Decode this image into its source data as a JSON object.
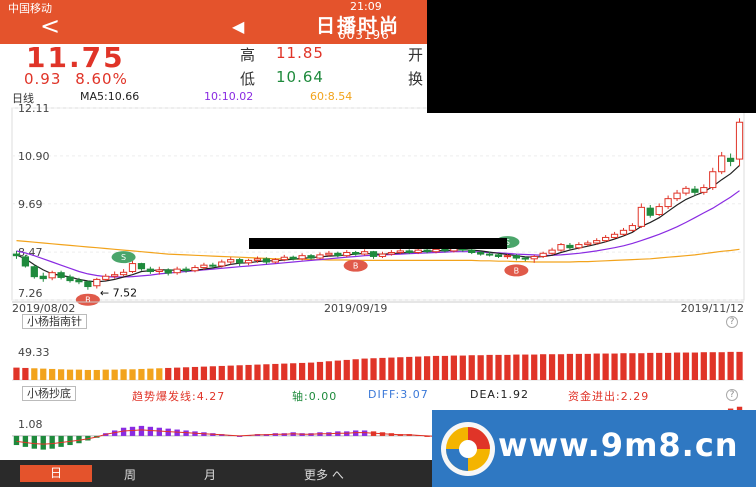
{
  "status": {
    "carrier": "中国移动",
    "time": "21:09"
  },
  "header": {
    "back_icon": "chevron-left",
    "stock_name": "日播时尚",
    "stock_code": "603196"
  },
  "quote": {
    "price": "11.75",
    "change": "0.93",
    "change_pct": "8.60%",
    "high_label": "高",
    "high": "11.85",
    "low_label": "低",
    "low": "10.64",
    "open_label": "开",
    "turnover_label": "换"
  },
  "legend": {
    "period": "日线",
    "ma5": "MA5:10.66",
    "ma10": "10:10.02",
    "ma60": "60:8.54"
  },
  "colors": {
    "up": "#e03428",
    "down": "#1e8a3c",
    "ma5": "#222222",
    "ma10": "#8a2be2",
    "ma60": "#f2a31c",
    "accent": "#e4532c"
  },
  "chart_data": {
    "type": "candlestick",
    "y_ticks": [
      "12.11",
      "10.90",
      "9.69",
      "8.47",
      "7.26"
    ],
    "ylim": [
      7.26,
      12.11
    ],
    "x_labels": [
      "2019/08/02",
      "2019/09/19",
      "2019/11/12"
    ],
    "annotations": {
      "low_marker": "7.52"
    },
    "candles": [
      [
        8.42,
        8.38,
        8.5,
        8.3
      ],
      [
        8.35,
        8.12,
        8.4,
        8.08
      ],
      [
        8.1,
        7.85,
        8.15,
        7.8
      ],
      [
        7.86,
        7.8,
        7.95,
        7.72
      ],
      [
        7.82,
        7.95,
        8.0,
        7.76
      ],
      [
        7.95,
        7.83,
        8.0,
        7.78
      ],
      [
        7.84,
        7.75,
        7.9,
        7.7
      ],
      [
        7.76,
        7.72,
        7.82,
        7.66
      ],
      [
        7.72,
        7.6,
        7.75,
        7.52
      ],
      [
        7.62,
        7.78,
        7.82,
        7.55
      ],
      [
        7.78,
        7.86,
        7.92,
        7.74
      ],
      [
        7.86,
        7.9,
        7.98,
        7.8
      ],
      [
        7.9,
        7.96,
        8.04,
        7.86
      ],
      [
        7.98,
        8.18,
        8.25,
        7.94
      ],
      [
        8.18,
        8.05,
        8.2,
        8.0
      ],
      [
        8.04,
        7.98,
        8.1,
        7.92
      ],
      [
        7.98,
        8.02,
        8.1,
        7.9
      ],
      [
        8.02,
        7.94,
        8.06,
        7.88
      ],
      [
        7.95,
        8.04,
        8.1,
        7.9
      ],
      [
        8.04,
        8.0,
        8.1,
        7.95
      ],
      [
        8.0,
        8.08,
        8.14,
        7.96
      ],
      [
        8.08,
        8.14,
        8.2,
        8.02
      ],
      [
        8.14,
        8.12,
        8.2,
        8.06
      ],
      [
        8.12,
        8.22,
        8.28,
        8.08
      ],
      [
        8.22,
        8.28,
        8.34,
        8.16
      ],
      [
        8.28,
        8.2,
        8.32,
        8.12
      ],
      [
        8.2,
        8.26,
        8.3,
        8.14
      ],
      [
        8.26,
        8.3,
        8.36,
        8.2
      ],
      [
        8.3,
        8.22,
        8.34,
        8.16
      ],
      [
        8.22,
        8.28,
        8.32,
        8.18
      ],
      [
        8.28,
        8.34,
        8.4,
        8.24
      ],
      [
        8.34,
        8.3,
        8.38,
        8.26
      ],
      [
        8.3,
        8.38,
        8.44,
        8.26
      ],
      [
        8.38,
        8.32,
        8.42,
        8.28
      ],
      [
        8.32,
        8.4,
        8.46,
        8.28
      ],
      [
        8.4,
        8.44,
        8.5,
        8.36
      ],
      [
        8.44,
        8.38,
        8.48,
        8.34
      ],
      [
        8.38,
        8.46,
        8.52,
        8.34
      ],
      [
        8.46,
        8.42,
        8.5,
        8.38
      ],
      [
        8.42,
        8.48,
        8.54,
        8.38
      ],
      [
        8.48,
        8.36,
        8.5,
        8.3
      ],
      [
        8.36,
        8.42,
        8.48,
        8.32
      ],
      [
        8.42,
        8.46,
        8.52,
        8.38
      ],
      [
        8.46,
        8.5,
        8.56,
        8.42
      ],
      [
        8.5,
        8.46,
        8.54,
        8.42
      ],
      [
        8.46,
        8.52,
        8.58,
        8.42
      ],
      [
        8.52,
        8.48,
        8.56,
        8.44
      ],
      [
        8.48,
        8.54,
        8.6,
        8.44
      ],
      [
        8.54,
        8.5,
        8.58,
        8.46
      ],
      [
        8.5,
        8.56,
        8.62,
        8.46
      ],
      [
        8.56,
        8.52,
        8.6,
        8.48
      ],
      [
        8.52,
        8.46,
        8.56,
        8.42
      ],
      [
        8.46,
        8.42,
        8.5,
        8.38
      ],
      [
        8.42,
        8.4,
        8.48,
        8.36
      ],
      [
        8.4,
        8.36,
        8.44,
        8.32
      ],
      [
        8.36,
        8.38,
        8.42,
        8.3
      ],
      [
        8.38,
        8.32,
        8.42,
        8.26
      ],
      [
        8.32,
        8.3,
        8.36,
        8.24
      ],
      [
        8.3,
        8.36,
        8.4,
        8.2
      ],
      [
        8.36,
        8.44,
        8.48,
        8.32
      ],
      [
        8.44,
        8.52,
        8.58,
        8.4
      ],
      [
        8.52,
        8.66,
        8.7,
        8.48
      ],
      [
        8.64,
        8.58,
        8.7,
        8.54
      ],
      [
        8.58,
        8.66,
        8.72,
        8.54
      ],
      [
        8.66,
        8.7,
        8.76,
        8.62
      ],
      [
        8.7,
        8.76,
        8.82,
        8.66
      ],
      [
        8.76,
        8.84,
        8.9,
        8.72
      ],
      [
        8.84,
        8.92,
        8.98,
        8.8
      ],
      [
        8.92,
        9.02,
        9.08,
        8.88
      ],
      [
        9.02,
        9.14,
        9.2,
        8.98
      ],
      [
        9.12,
        9.6,
        9.7,
        9.08
      ],
      [
        9.58,
        9.4,
        9.66,
        9.34
      ],
      [
        9.42,
        9.62,
        9.7,
        9.38
      ],
      [
        9.62,
        9.82,
        9.9,
        9.56
      ],
      [
        9.82,
        9.96,
        10.04,
        9.76
      ],
      [
        9.96,
        10.08,
        10.14,
        9.9
      ],
      [
        10.06,
        9.98,
        10.14,
        9.9
      ],
      [
        9.98,
        10.1,
        10.18,
        9.92
      ],
      [
        10.1,
        10.5,
        10.6,
        10.04
      ],
      [
        10.5,
        10.9,
        11.0,
        10.44
      ],
      [
        10.84,
        10.76,
        10.96,
        10.64
      ],
      [
        10.82,
        11.75,
        11.85,
        10.64
      ]
    ],
    "ma5": [
      8.4,
      8.3,
      8.15,
      8.02,
      7.92,
      7.88,
      7.84,
      7.78,
      7.74,
      7.72,
      7.74,
      7.78,
      7.84,
      7.9,
      7.98,
      8.0,
      8.02,
      8.02,
      8.01,
      8.0,
      8.01,
      8.04,
      8.07,
      8.11,
      8.16,
      8.19,
      8.2,
      8.23,
      8.25,
      8.25,
      8.27,
      8.29,
      8.31,
      8.33,
      8.35,
      8.37,
      8.38,
      8.4,
      8.42,
      8.44,
      8.42,
      8.42,
      8.43,
      8.45,
      8.46,
      8.48,
      8.49,
      8.5,
      8.51,
      8.52,
      8.53,
      8.52,
      8.5,
      8.47,
      8.44,
      8.41,
      8.38,
      8.35,
      8.34,
      8.36,
      8.39,
      8.46,
      8.52,
      8.57,
      8.62,
      8.67,
      8.73,
      8.8,
      8.88,
      8.97,
      9.12,
      9.22,
      9.34,
      9.5,
      9.66,
      9.8,
      9.9,
      9.99,
      10.13,
      10.3,
      10.45,
      10.66
    ],
    "ma10": [
      8.5,
      8.45,
      8.38,
      8.3,
      8.22,
      8.14,
      8.06,
      7.98,
      7.92,
      7.88,
      7.85,
      7.84,
      7.84,
      7.85,
      7.87,
      7.89,
      7.92,
      7.94,
      7.96,
      7.98,
      8.0,
      8.02,
      8.04,
      8.06,
      8.08,
      8.1,
      8.12,
      8.14,
      8.16,
      8.18,
      8.2,
      8.22,
      8.24,
      8.26,
      8.28,
      8.3,
      8.32,
      8.34,
      8.36,
      8.38,
      8.39,
      8.4,
      8.41,
      8.42,
      8.43,
      8.44,
      8.45,
      8.46,
      8.47,
      8.48,
      8.48,
      8.48,
      8.47,
      8.46,
      8.45,
      8.44,
      8.42,
      8.41,
      8.4,
      8.39,
      8.39,
      8.4,
      8.42,
      8.44,
      8.47,
      8.5,
      8.54,
      8.58,
      8.63,
      8.69,
      8.76,
      8.84,
      8.92,
      9.01,
      9.11,
      9.22,
      9.34,
      9.46,
      9.58,
      9.72,
      9.86,
      10.02
    ],
    "ma60": [
      8.76,
      8.74,
      8.72,
      8.7,
      8.68,
      8.66,
      8.64,
      8.62,
      8.6,
      8.58,
      8.56,
      8.54,
      8.52,
      8.5,
      8.48,
      8.46,
      8.44,
      8.42,
      8.41,
      8.4,
      8.39,
      8.38,
      8.37,
      8.36,
      8.35,
      8.34,
      8.33,
      8.32,
      8.31,
      8.3,
      8.3,
      8.29,
      8.29,
      8.28,
      8.28,
      8.27,
      8.27,
      8.27,
      8.26,
      8.26,
      8.26,
      8.26,
      8.26,
      8.26,
      8.26,
      8.26,
      8.26,
      8.26,
      8.26,
      8.26,
      8.26,
      8.26,
      8.25,
      8.25,
      8.24,
      8.24,
      8.23,
      8.23,
      8.22,
      8.22,
      8.22,
      8.22,
      8.22,
      8.23,
      8.23,
      8.24,
      8.25,
      8.26,
      8.27,
      8.28,
      8.29,
      8.3,
      8.32,
      8.34,
      8.36,
      8.38,
      8.4,
      8.43,
      8.46,
      8.49,
      8.51,
      8.54
    ],
    "signals": [
      {
        "candle": 8,
        "type": "buy",
        "label": "B"
      },
      {
        "candle": 12,
        "type": "sell",
        "label": "S"
      },
      {
        "candle": 38,
        "type": "buy",
        "label": "B"
      },
      {
        "candle": 55,
        "type": "sell",
        "label": "S"
      },
      {
        "candle": 56,
        "type": "buy",
        "label": "B"
      }
    ],
    "indicator1": {
      "title": "小杨指南针",
      "tick": "49.33",
      "values": [
        37,
        36,
        35,
        34,
        33,
        32,
        31,
        31,
        30,
        30,
        31,
        31,
        32,
        32,
        33,
        34,
        35,
        36,
        37,
        38,
        39,
        40,
        41,
        42,
        43,
        44,
        45,
        46,
        47,
        48,
        49,
        50,
        51,
        52,
        54,
        56,
        58,
        60,
        62,
        64,
        65,
        66,
        67,
        68,
        69,
        70,
        71,
        72,
        72,
        73,
        73,
        74,
        74,
        75,
        75,
        75,
        76,
        76,
        76,
        77,
        77,
        77,
        78,
        78,
        78,
        79,
        79,
        79,
        80,
        80,
        80,
        81,
        81,
        81,
        82,
        82,
        82,
        83,
        83,
        83,
        84,
        84
      ],
      "ylim": [
        0,
        100
      ]
    },
    "indicator2": {
      "title": "小杨抄底",
      "trend": "趋势爆发线:4.27",
      "axis": "轴:0.00",
      "diff": "DIFF:3.07",
      "dea": "DEA:1.92",
      "capital": "资金进出:2.29",
      "tick": "1.08",
      "bars": [
        -1,
        -1.2,
        -1.4,
        -1.5,
        -1.4,
        -1.2,
        -1.0,
        -0.8,
        -0.5,
        -0.2,
        0.3,
        0.6,
        0.9,
        1.0,
        1.1,
        1.0,
        0.9,
        0.8,
        0.7,
        0.6,
        0.5,
        0.4,
        0.3,
        0.2,
        0.1,
        0.0,
        0.1,
        0.2,
        0.2,
        0.3,
        0.3,
        0.4,
        0.3,
        0.3,
        0.4,
        0.4,
        0.5,
        0.5,
        0.6,
        0.6,
        0.5,
        0.4,
        0.3,
        0.2,
        0.2,
        0.1,
        0.0,
        -0.1,
        -0.2,
        -0.2,
        -0.3,
        -0.3,
        -0.4,
        -0.4,
        -0.5,
        -0.5,
        -0.4,
        -0.3,
        -0.2,
        0.0,
        0.2,
        0.4,
        0.6,
        0.8,
        1.0,
        1.2,
        1.3,
        1.4,
        1.5,
        1.6,
        1.8,
        1.9,
        2.0,
        2.1,
        2.2,
        2.3,
        2.4,
        2.5,
        2.6,
        2.8,
        3.0,
        3.2
      ],
      "ylim": [
        -2.2,
        3.5
      ]
    }
  },
  "tabs": [
    "日",
    "周",
    "月",
    "更多 へ"
  ],
  "watermark": {
    "text": "www.9m8.cn"
  }
}
